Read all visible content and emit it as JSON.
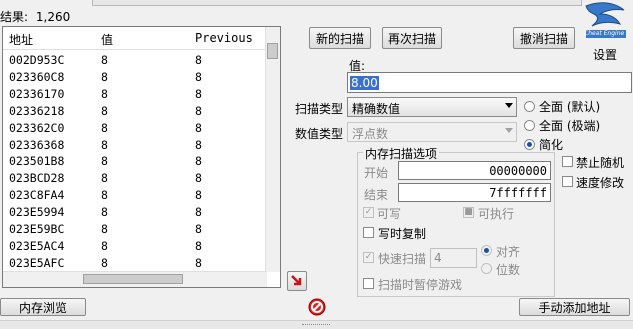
{
  "results": {
    "label": "结果:",
    "count": "1,260"
  },
  "table": {
    "headers": [
      "地址",
      "值",
      "Previous"
    ],
    "rows": [
      [
        "002D953C",
        "8",
        "8"
      ],
      [
        "023360C8",
        "8",
        "8"
      ],
      [
        "02336170",
        "8",
        "8"
      ],
      [
        "02336218",
        "8",
        "8"
      ],
      [
        "023362C0",
        "8",
        "8"
      ],
      [
        "02336368",
        "8",
        "8"
      ],
      [
        "023501B8",
        "8",
        "8"
      ],
      [
        "023BCD28",
        "8",
        "8"
      ],
      [
        "023C8FA4",
        "8",
        "8"
      ],
      [
        "023E5994",
        "8",
        "8"
      ],
      [
        "023E59BC",
        "8",
        "8"
      ],
      [
        "023E5AC4",
        "8",
        "8"
      ],
      [
        "023E5AFC",
        "8",
        "8"
      ]
    ]
  },
  "buttons": {
    "new_scan": "新的扫描",
    "next_scan": "再次扫描",
    "undo_scan": "撤消扫描",
    "memory_view": "内存浏览",
    "add_address": "手动添加地址"
  },
  "settings": {
    "label": "设置",
    "logo_text": "Cheat Engine"
  },
  "value": {
    "label": "值:",
    "current": "8.00"
  },
  "scan_type": {
    "label": "扫描类型",
    "selected": "精确数值"
  },
  "value_type": {
    "label": "数值类型",
    "selected": "浮点数"
  },
  "radios": {
    "all_default": "全面 (默认)",
    "all_extreme": "全面 (极端)",
    "simplify": "简化"
  },
  "mem_options": {
    "title": "内存扫描选项",
    "start_label": "开始",
    "start_value": "00000000",
    "end_label": "结束",
    "end_value": "7fffffff",
    "writable": "可写",
    "executable": "可执行",
    "copy_on_write": "写时复制",
    "fast_scan": "快速扫描",
    "fast_scan_value": "4",
    "align": "对齐",
    "last_digits": "位数",
    "pause_game": "扫描时暂停游戏"
  },
  "right_checks": {
    "disable_random": "禁止随机",
    "speedhack": "速度修改"
  },
  "colors": {
    "selection": "#3a6fd0",
    "panel": "#f0f0f0"
  }
}
